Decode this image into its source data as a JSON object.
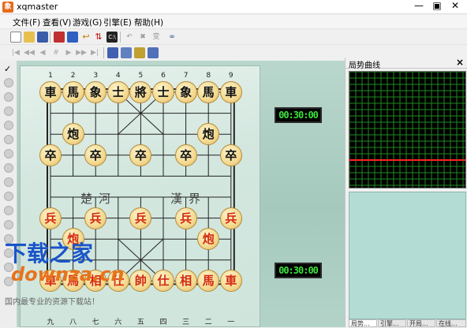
{
  "window": {
    "title": "xqmaster",
    "icon": "app-logo-icon",
    "min": "—",
    "max": "▣",
    "close": "✕"
  },
  "menu": [
    "文件(F)",
    "查看(V)",
    "游戏(G)",
    "引擎(E)",
    "帮助(H)"
  ],
  "toolbar1": [
    "new-icon",
    "open-icon",
    "save-icon",
    "board-icon",
    "board-setup-icon",
    "undo-move-icon",
    "flip-icon",
    "engine-icon",
    "undo-icon",
    "stop-icon",
    "transform-icon",
    "binoculars-icon"
  ],
  "toolbar2": [
    "first-icon",
    "prev-icon",
    "prev-fast-icon",
    "hash-icon",
    "next-fast-icon",
    "next-icon",
    "last-icon",
    "copy-icon",
    "paste-icon",
    "copy-board-icon",
    "paste-board-icon"
  ],
  "board": {
    "top_file_numbers": [
      "1",
      "2",
      "3",
      "4",
      "5",
      "6",
      "7",
      "8",
      "9"
    ],
    "bottom_file_numbers": [
      "九",
      "八",
      "七",
      "六",
      "五",
      "四",
      "三",
      "二",
      "一"
    ],
    "river_left": "楚河",
    "river_right": "漢界",
    "pieces": [
      {
        "text": "車",
        "side": "black",
        "file": 0,
        "rank": 0
      },
      {
        "text": "馬",
        "side": "black",
        "file": 1,
        "rank": 0
      },
      {
        "text": "象",
        "side": "black",
        "file": 2,
        "rank": 0
      },
      {
        "text": "士",
        "side": "black",
        "file": 3,
        "rank": 0
      },
      {
        "text": "將",
        "side": "black",
        "file": 4,
        "rank": 0
      },
      {
        "text": "士",
        "side": "black",
        "file": 5,
        "rank": 0
      },
      {
        "text": "象",
        "side": "black",
        "file": 6,
        "rank": 0
      },
      {
        "text": "馬",
        "side": "black",
        "file": 7,
        "rank": 0
      },
      {
        "text": "車",
        "side": "black",
        "file": 8,
        "rank": 0
      },
      {
        "text": "炮",
        "side": "black",
        "file": 1,
        "rank": 2
      },
      {
        "text": "炮",
        "side": "black",
        "file": 7,
        "rank": 2
      },
      {
        "text": "卒",
        "side": "black",
        "file": 0,
        "rank": 3
      },
      {
        "text": "卒",
        "side": "black",
        "file": 2,
        "rank": 3
      },
      {
        "text": "卒",
        "side": "black",
        "file": 4,
        "rank": 3
      },
      {
        "text": "卒",
        "side": "black",
        "file": 6,
        "rank": 3
      },
      {
        "text": "卒",
        "side": "black",
        "file": 8,
        "rank": 3
      },
      {
        "text": "兵",
        "side": "red",
        "file": 0,
        "rank": 6
      },
      {
        "text": "兵",
        "side": "red",
        "file": 2,
        "rank": 6
      },
      {
        "text": "兵",
        "side": "red",
        "file": 4,
        "rank": 6
      },
      {
        "text": "兵",
        "side": "red",
        "file": 6,
        "rank": 6
      },
      {
        "text": "兵",
        "side": "red",
        "file": 8,
        "rank": 6
      },
      {
        "text": "炮",
        "side": "red",
        "file": 1,
        "rank": 7
      },
      {
        "text": "炮",
        "side": "red",
        "file": 7,
        "rank": 7
      },
      {
        "text": "車",
        "side": "red",
        "file": 0,
        "rank": 9
      },
      {
        "text": "馬",
        "side": "red",
        "file": 1,
        "rank": 9
      },
      {
        "text": "相",
        "side": "red",
        "file": 2,
        "rank": 9
      },
      {
        "text": "仕",
        "side": "red",
        "file": 3,
        "rank": 9
      },
      {
        "text": "帥",
        "side": "red",
        "file": 4,
        "rank": 9
      },
      {
        "text": "仕",
        "side": "red",
        "file": 5,
        "rank": 9
      },
      {
        "text": "相",
        "side": "red",
        "file": 6,
        "rank": 9
      },
      {
        "text": "馬",
        "side": "red",
        "file": 7,
        "rank": 9
      },
      {
        "text": "車",
        "side": "red",
        "file": 8,
        "rank": 9
      }
    ]
  },
  "clocks": {
    "top": "00:30:00",
    "bottom": "00:30:00"
  },
  "watermark": {
    "line1": "下载之家",
    "line2": "downza.cn",
    "line3": "国内最专业的资源下载站！"
  },
  "right_panel": {
    "title": "局势曲线",
    "close": "×",
    "tabs": [
      "局势...",
      "引擎...",
      "开局...",
      "在线..."
    ]
  },
  "colors": {
    "board_bg": "#d3e7df",
    "graph_grid": "#1f8a1f",
    "graph_line": "#ff2020",
    "clock_text": "#3ce23c"
  }
}
